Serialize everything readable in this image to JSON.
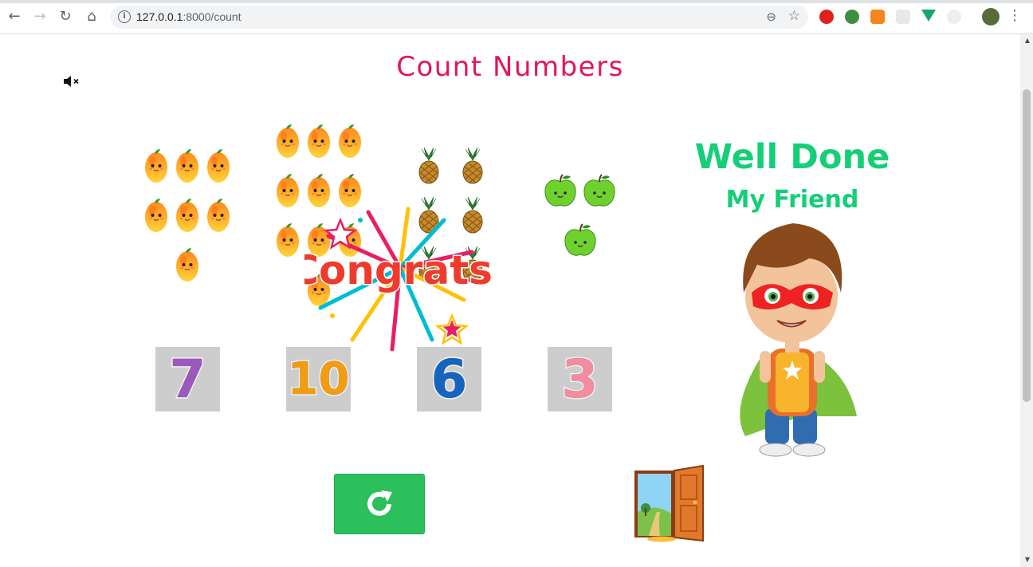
{
  "browser": {
    "url_host": "127.0.0.1",
    "url_path": ":8000/count"
  },
  "page": {
    "title": "Count Numbers",
    "well_done": "Well Done",
    "my_friend": "My Friend",
    "congrats_text": "Congrats!"
  },
  "groups": [
    {
      "fruit": "mango",
      "count": 7
    },
    {
      "fruit": "mango",
      "count": 10
    },
    {
      "fruit": "pineapple",
      "count": 6
    },
    {
      "fruit": "apple",
      "count": 3
    }
  ],
  "numbers": [
    {
      "value": "7",
      "color": "#9b59c0"
    },
    {
      "value": "10",
      "color": "#f39c12"
    },
    {
      "value": "6",
      "color": "#1565c0"
    },
    {
      "value": "3",
      "color": "#f48ca0"
    }
  ],
  "colors": {
    "title": "#e3165b",
    "praise": "#15cf78",
    "button": "#2cc05d",
    "card": "#cdcdcd"
  },
  "icons": {
    "mute": "speaker-mute-icon",
    "reload": "reload-icon",
    "exit": "door-icon"
  }
}
